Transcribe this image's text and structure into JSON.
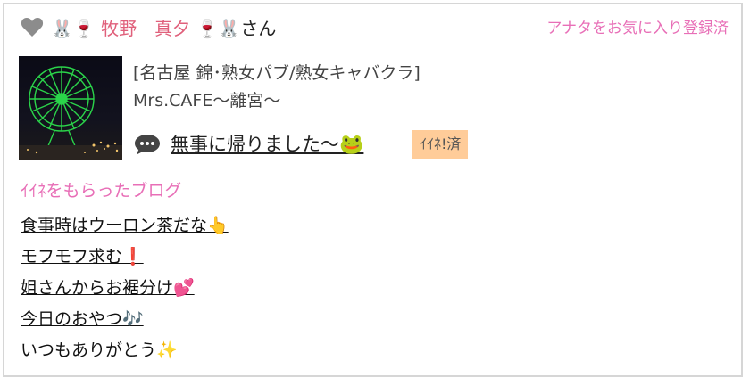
{
  "header": {
    "name_prefix_emojis": "🐰🍷",
    "name": "牧野　真夕",
    "name_suffix_emojis": "🍷🐰",
    "honorific": "さん",
    "favorite_status": "アナタをお気に入り登録済"
  },
  "store": {
    "line1": "[名古屋 錦･熟女パブ/熟女キャバクラ]",
    "line2": "Mrs.CAFE〜離宮〜"
  },
  "post": {
    "title": "無事に帰りました〜",
    "title_emoji": "🐸",
    "iine_badge": "ｲｲﾈ!済"
  },
  "liked_blogs": {
    "title": "ｲｲﾈをもらったブログ",
    "items": [
      "食事時はウーロン茶だな👆",
      "モフモフ求む❗️",
      "姐さんからお裾分け💕",
      "今日のおやつ🎶",
      "いつもありがとう✨"
    ]
  },
  "colors": {
    "accent_pink": "#e86fb7",
    "name_pink": "#e0607b",
    "badge_bg": "#ffcc99",
    "border": "#d6d6d6"
  }
}
